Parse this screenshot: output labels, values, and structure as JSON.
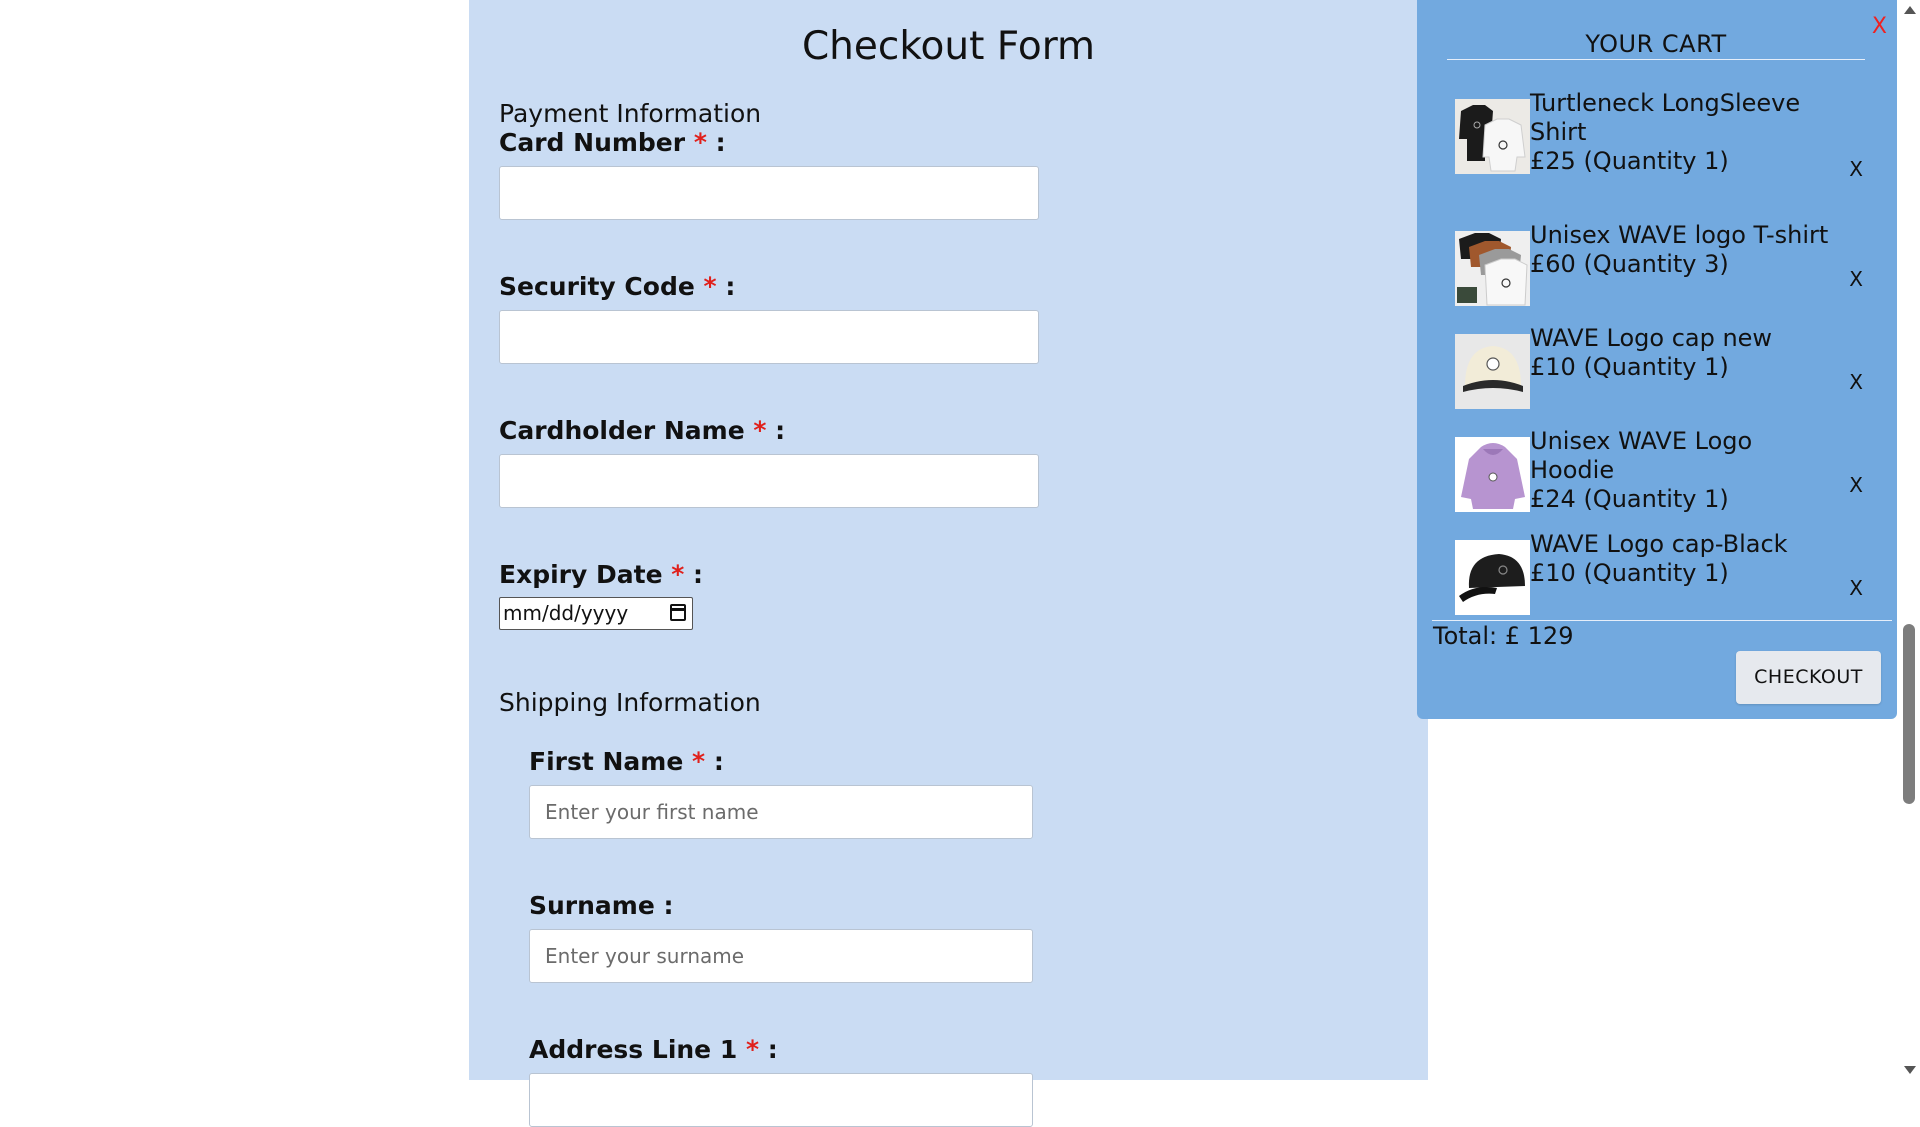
{
  "form": {
    "title": "Checkout Form",
    "payment_heading": "Payment Information",
    "card_number_label": "Card Number",
    "security_code_label": "Security Code",
    "cardholder_name_label": "Cardholder Name",
    "expiry_date_label": "Expiry Date",
    "expiry_date_placeholder": "mm/dd/yyyy",
    "shipping_heading": "Shipping Information",
    "first_name_label": "First Name",
    "first_name_placeholder": "Enter your first name",
    "surname_label": "Surname :",
    "surname_placeholder": "Enter your surname",
    "address_line1_label": "Address Line 1",
    "required_marker": "*",
    "label_suffix": " :"
  },
  "cart": {
    "title": "YOUR CART",
    "close_label": "X",
    "items": [
      {
        "name": "Turtleneck LongSleeve Shirt",
        "price_qty": "£25 (Quantity 1)",
        "remove_label": "X",
        "thumb": "turtleneck-shirt-image"
      },
      {
        "name": "Unisex WAVE logo T-shirt",
        "price_qty": "£60 (Quantity 3)",
        "remove_label": "X",
        "thumb": "tshirt-stack-image"
      },
      {
        "name": "WAVE Logo cap new",
        "price_qty": "£10 (Quantity 1)",
        "remove_label": "X",
        "thumb": "cream-cap-image"
      },
      {
        "name": "Unisex WAVE Logo Hoodie",
        "price_qty": "£24 (Quantity 1)",
        "remove_label": "X",
        "thumb": "purple-hoodie-image"
      },
      {
        "name": "WAVE Logo cap-Black",
        "price_qty": "£10 (Quantity 1)",
        "remove_label": "X",
        "thumb": "black-cap-image"
      }
    ],
    "total_label": "Total: £ 129",
    "checkout_label": "CHECKOUT"
  },
  "colors": {
    "form_bg": "#cadcf3",
    "cart_bg": "#72a9df",
    "required": "#e0201b",
    "close": "#ee2222"
  }
}
